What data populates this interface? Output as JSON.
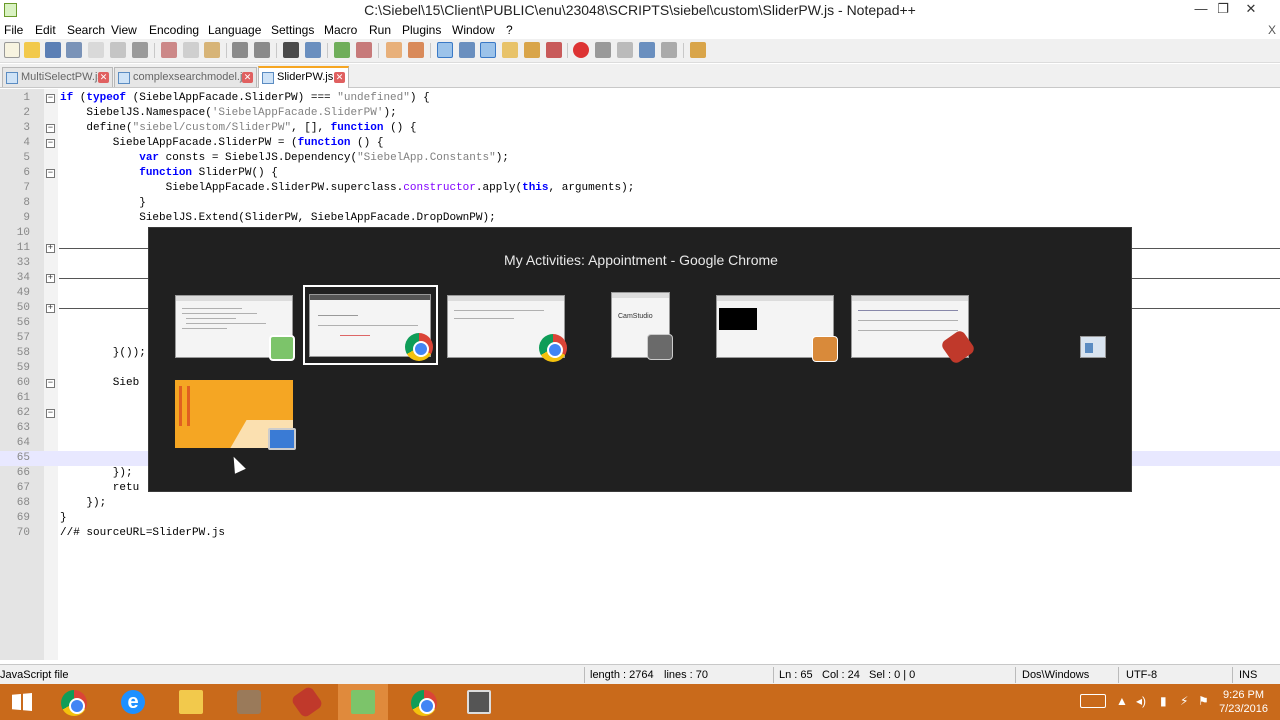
{
  "window": {
    "title": "C:\\Siebel\\15\\Client\\PUBLIC\\enu\\23048\\SCRIPTS\\siebel\\custom\\SliderPW.js - Notepad++",
    "minimize": "—",
    "restore": "❐",
    "close": "✕"
  },
  "menu": {
    "items": [
      "File",
      "Edit",
      "Search",
      "View",
      "Encoding",
      "Language",
      "Settings",
      "Macro",
      "Run",
      "Plugins",
      "Window",
      "?"
    ],
    "close_doc": "X"
  },
  "tabs": [
    {
      "label": "MultiSelectPW.js",
      "active": false
    },
    {
      "label": "complexsearchmodel.js",
      "active": false
    },
    {
      "label": "SliderPW.js",
      "active": true
    }
  ],
  "editor": {
    "current_line": "65",
    "lines": [
      {
        "n": "1",
        "fold": "−",
        "code": "if (typeof (SiebelAppFacade.SliderPW) === \"undefined\") {"
      },
      {
        "n": "2",
        "fold": "",
        "code": "    SiebelJS.Namespace('SiebelAppFacade.SliderPW');"
      },
      {
        "n": "3",
        "fold": "−",
        "code": "    define(\"siebel/custom/SliderPW\", [], function () {"
      },
      {
        "n": "4",
        "fold": "−",
        "code": "        SiebelAppFacade.SliderPW = (function () {"
      },
      {
        "n": "5",
        "fold": "",
        "code": "            var consts = SiebelJS.Dependency(\"SiebelApp.Constants\");"
      },
      {
        "n": "6",
        "fold": "−",
        "code": "            function SliderPW() {"
      },
      {
        "n": "7",
        "fold": "",
        "code": "                SiebelAppFacade.SliderPW.superclass.constructor.apply(this, arguments);"
      },
      {
        "n": "8",
        "fold": "",
        "code": "            }"
      },
      {
        "n": "9",
        "fold": "",
        "code": "            SiebelJS.Extend(SliderPW, SiebelAppFacade.DropDownPW);"
      },
      {
        "n": "10",
        "fold": "",
        "code": ""
      },
      {
        "n": "11",
        "fold": "+",
        "code": ""
      },
      {
        "n": "33",
        "fold": "",
        "code": ""
      },
      {
        "n": "34",
        "fold": "+",
        "code": ""
      },
      {
        "n": "49",
        "fold": "",
        "code": ""
      },
      {
        "n": "50",
        "fold": "+",
        "code": ""
      },
      {
        "n": "56",
        "fold": "",
        "code": ""
      },
      {
        "n": "57",
        "fold": "",
        "code": ""
      },
      {
        "n": "58",
        "fold": "",
        "code": "        }());"
      },
      {
        "n": "59",
        "fold": "",
        "code": ""
      },
      {
        "n": "60",
        "fold": "−",
        "code": "        Sieb"
      },
      {
        "n": "61",
        "fold": "",
        "code": ""
      },
      {
        "n": "62",
        "fold": "−",
        "code": ""
      },
      {
        "n": "63",
        "fold": "",
        "code": ""
      },
      {
        "n": "64",
        "fold": "",
        "code": ""
      },
      {
        "n": "65",
        "fold": "",
        "code": ""
      },
      {
        "n": "66",
        "fold": "",
        "code": "        });"
      },
      {
        "n": "67",
        "fold": "",
        "code": "        retu"
      },
      {
        "n": "68",
        "fold": "",
        "code": "    });"
      },
      {
        "n": "69",
        "fold": "",
        "code": "}"
      },
      {
        "n": "70",
        "fold": "",
        "code": "//# sourceURL=SliderPW.js"
      }
    ]
  },
  "switcher": {
    "title": "My Activities: Appointment - Google Chrome",
    "windows": [
      {
        "name": "notepad++",
        "badge": "notepad-icon"
      },
      {
        "name": "chrome-appointment",
        "badge": "chrome-icon",
        "selected": true
      },
      {
        "name": "chrome-2",
        "badge": "chrome-icon"
      },
      {
        "name": "camstudio",
        "badge": "camera-icon",
        "label": "CamStudio"
      },
      {
        "name": "video-editor",
        "badge": "media-icon"
      },
      {
        "name": "siebel-tools",
        "badge": "tools-icon"
      },
      {
        "name": "small-window",
        "badge": "window-icon"
      },
      {
        "name": "desktop",
        "badge": "desktop-icon"
      }
    ]
  },
  "status": {
    "filetype": "JavaScript file",
    "length": "length : 2764",
    "lines": "lines : 70",
    "ln": "Ln : 65",
    "col": "Col : 24",
    "sel": "Sel : 0 | 0",
    "eol": "Dos\\Windows",
    "encoding": "UTF-8",
    "mode": "INS"
  },
  "taskbar": {
    "time": "9:26 PM",
    "date": "7/23/2016",
    "apps": [
      "start",
      "chrome",
      "internet-explorer",
      "file-explorer",
      "siebel-tools-1",
      "siebel-tools-2",
      "notepad-plus-plus",
      "chrome-2",
      "camstudio"
    ]
  },
  "colors": {
    "taskbar": "#c96a1b",
    "switcher_bg": "#202020",
    "keyword": "#0000ff",
    "string": "#808080",
    "comment": "#008000"
  }
}
